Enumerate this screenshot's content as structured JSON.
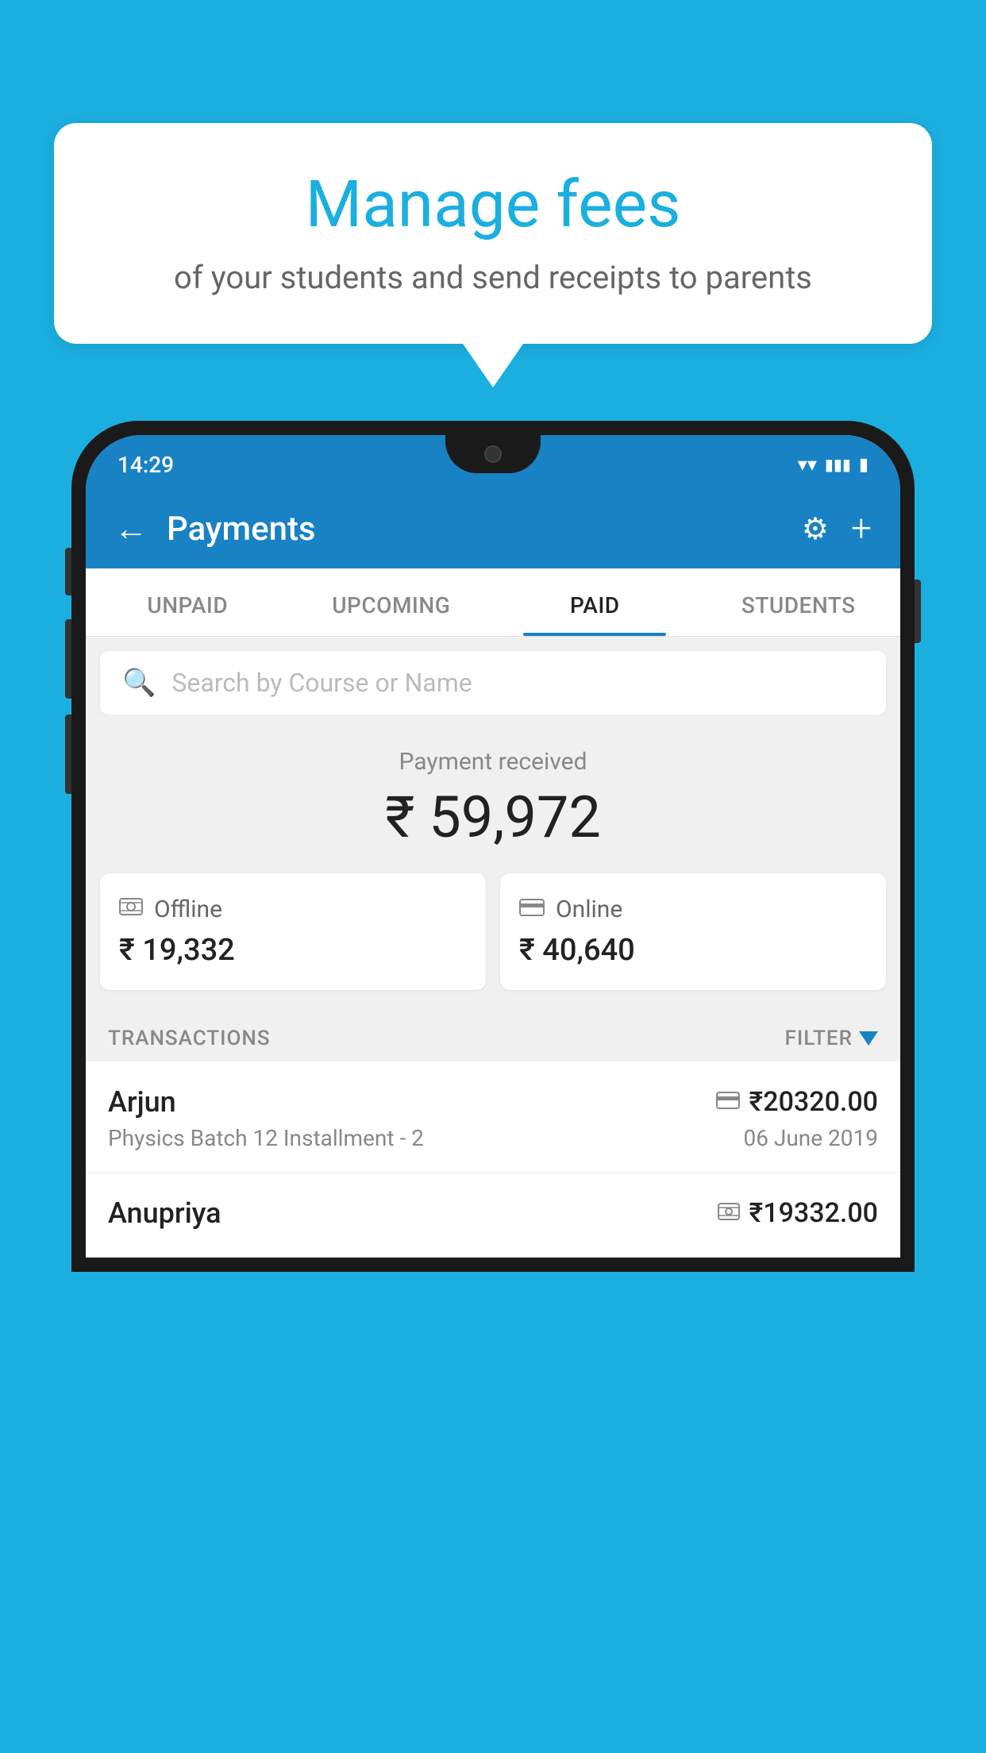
{
  "background_color": "#1BAFE0",
  "speech_bubble": {
    "title": "Manage fees",
    "subtitle": "of your students and send receipts to parents"
  },
  "status_bar": {
    "time": "14:29",
    "wifi": "▾",
    "signal": "▴",
    "battery": "▮"
  },
  "header": {
    "title": "Payments",
    "back_icon": "←",
    "settings_icon": "⚙",
    "add_icon": "+"
  },
  "tabs": [
    {
      "label": "UNPAID",
      "active": false
    },
    {
      "label": "UPCOMING",
      "active": false
    },
    {
      "label": "PAID",
      "active": true
    },
    {
      "label": "STUDENTS",
      "active": false
    }
  ],
  "search": {
    "placeholder": "Search by Course or Name"
  },
  "payment_summary": {
    "label": "Payment received",
    "amount": "₹ 59,972",
    "offline": {
      "label": "Offline",
      "amount": "₹ 19,332"
    },
    "online": {
      "label": "Online",
      "amount": "₹ 40,640"
    }
  },
  "transactions_header": {
    "label": "TRANSACTIONS",
    "filter_label": "FILTER"
  },
  "transactions": [
    {
      "name": "Arjun",
      "detail": "Physics Batch 12 Installment - 2",
      "amount": "₹20320.00",
      "date": "06 June 2019",
      "payment_type": "card"
    },
    {
      "name": "Anupriya",
      "detail": "",
      "amount": "₹19332.00",
      "date": "",
      "payment_type": "cash"
    }
  ]
}
